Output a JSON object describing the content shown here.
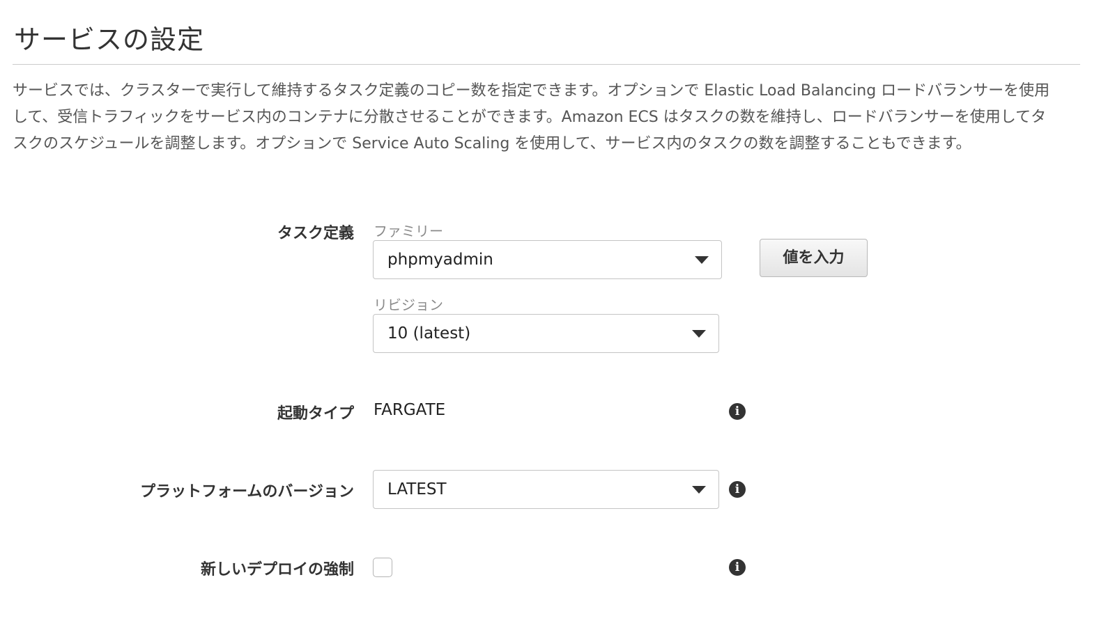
{
  "section": {
    "title": "サービスの設定",
    "description": "サービスでは、クラスターで実行して維持するタスク定義のコピー数を指定できます。オプションで Elastic Load Balancing ロードバランサーを使用して、受信トラフィックをサービス内のコンテナに分散させることができます。Amazon ECS はタスクの数を維持し、ロードバランサーを使用してタスクのスケジュールを調整します。オプションで Service Auto Scaling を使用して、サービス内のタスクの数を調整することもできます。"
  },
  "task_definition": {
    "label": "タスク定義",
    "family_label": "ファミリー",
    "family_value": "phpmyadmin",
    "revision_label": "リビジョン",
    "revision_value": "10 (latest)",
    "enter_value_button": "値を入力"
  },
  "launch_type": {
    "label": "起動タイプ",
    "value": "FARGATE",
    "info_icon": "info-icon"
  },
  "platform_version": {
    "label": "プラットフォームのバージョン",
    "value": "LATEST",
    "info_icon": "info-icon"
  },
  "force_new_deployment": {
    "label": "新しいデプロイの強制",
    "checked": false,
    "info_icon": "info-icon"
  },
  "icons": {
    "info_glyph": "i",
    "dropdown": "caret-down-icon"
  }
}
